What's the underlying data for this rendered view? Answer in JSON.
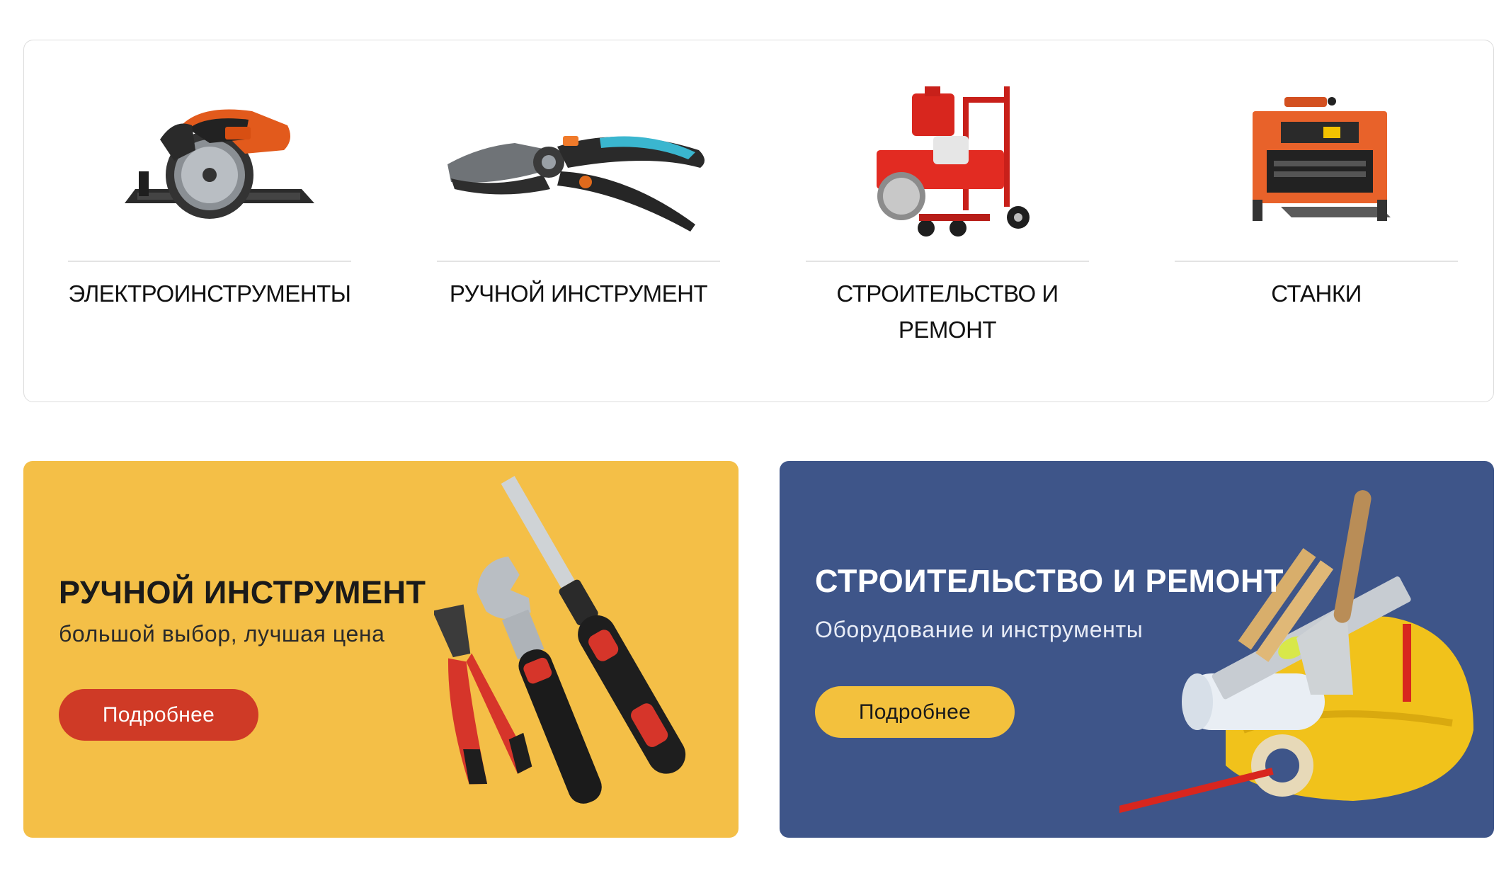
{
  "categories": [
    {
      "label": "Электроинструменты",
      "icon": "circular-saw-icon"
    },
    {
      "label": "Ручной инструмент",
      "icon": "pruning-shears-icon"
    },
    {
      "label": "Строительство и ремонт",
      "icon": "floor-saw-cart-icon"
    },
    {
      "label": "Станки",
      "icon": "thickness-planer-icon"
    }
  ],
  "banners": [
    {
      "title": "РУЧНОЙ ИНСТРУМЕНТ",
      "subtitle": "большой выбор, лучшая цена",
      "button": "Подробнее",
      "background": "#f4bf47",
      "button_color": "#cf3a26"
    },
    {
      "title": "СТРОИТЕЛЬСТВО И РЕМОНТ",
      "subtitle": "Оборудование и инструменты",
      "button": "Подробнее",
      "background": "#3e5589",
      "button_color": "#f3c13d"
    }
  ]
}
